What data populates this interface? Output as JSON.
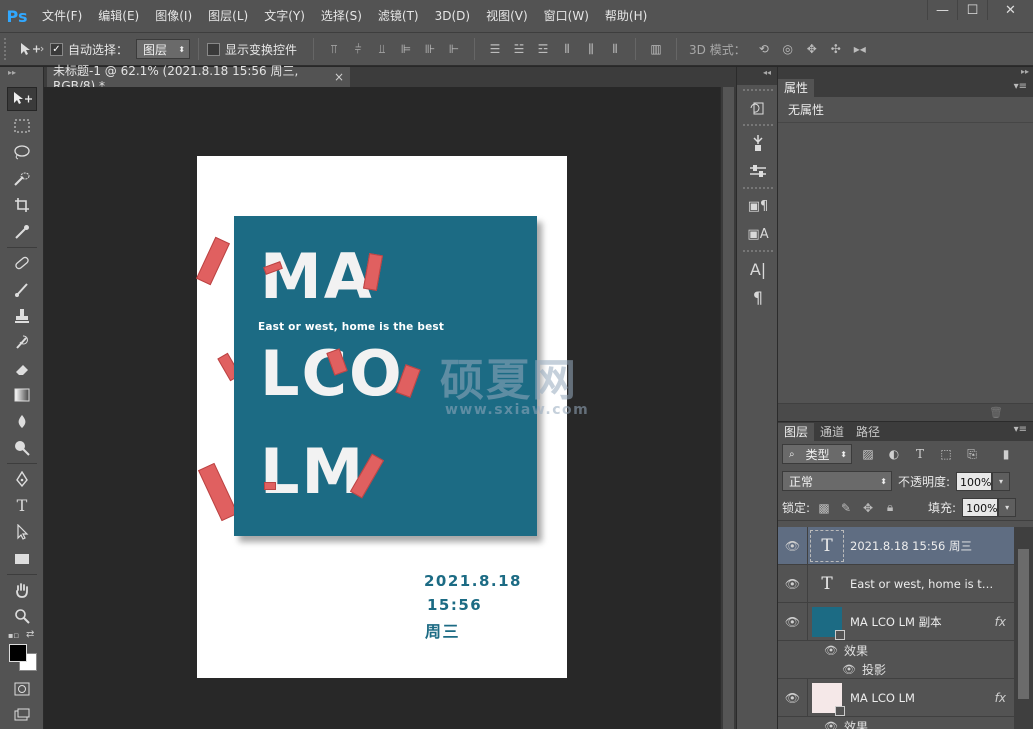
{
  "app": {
    "logo": "Ps"
  },
  "menu": [
    "文件(F)",
    "编辑(E)",
    "图像(I)",
    "图层(L)",
    "文字(Y)",
    "选择(S)",
    "滤镜(T)",
    "3D(D)",
    "视图(V)",
    "窗口(W)",
    "帮助(H)"
  ],
  "window_controls": {
    "minimize": "—",
    "maximize": "☐",
    "close": "✕"
  },
  "options": {
    "auto_select_label": "自动选择：",
    "auto_select_checked": true,
    "layer_select_value": "图层",
    "transform_controls_label": "显示变换控件",
    "transform_controls_checked": false,
    "mode_3d_label": "3D 模式："
  },
  "document": {
    "tab_title": "未标题-1 @ 62.1% (2021.8.18 15:56 周三, RGB/8) *",
    "close": "×"
  },
  "artwork": {
    "line1": "MA",
    "line2": "LCO",
    "line3": "LM",
    "subline": "East or west, home is the best",
    "date": "2021.8.18",
    "time": "15:56",
    "weekday": "周三",
    "accent_color": "#1c6b84",
    "ribbon_color": "#e06060"
  },
  "watermark": {
    "cn": "硕夏网",
    "url": "www.sxiaw.com"
  },
  "properties": {
    "tab": "属性",
    "info": "无属性"
  },
  "layers": {
    "tabs": [
      "图层",
      "通道",
      "路径"
    ],
    "kind_label": "类型",
    "blend_mode": "正常",
    "opacity_label": "不透明度:",
    "opacity_value": "100%",
    "lock_label": "锁定:",
    "fill_label": "填充:",
    "fill_value": "100%",
    "items": [
      {
        "name": "2021.8.18  15:56 周三",
        "type": "text",
        "selected": true
      },
      {
        "name": "East or west, home is the ...",
        "type": "text",
        "selected": false
      },
      {
        "name": "MA LCO LM 副本",
        "type": "image",
        "fx": "fx",
        "effects_label": "效果",
        "effect": "投影",
        "selected": false
      },
      {
        "name": "MA LCO LM",
        "type": "image2",
        "fx": "fx",
        "effects_label": "效果",
        "selected": false
      }
    ]
  }
}
